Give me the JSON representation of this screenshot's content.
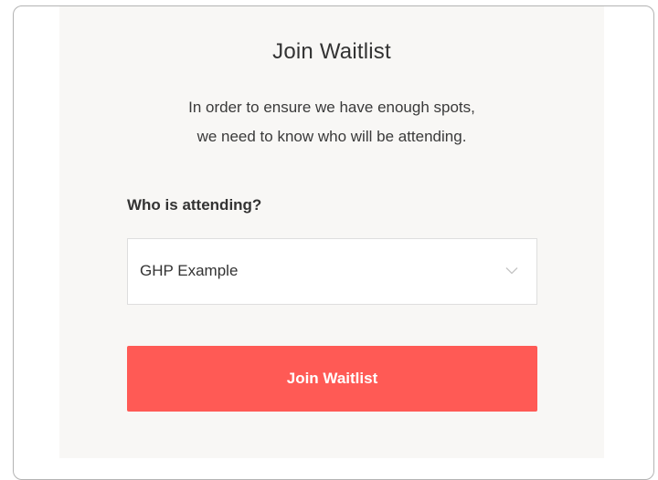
{
  "dialog": {
    "title": "Join Waitlist",
    "subtitle_line1": "In order to ensure we have enough spots,",
    "subtitle_line2": "we need to know who will be attending."
  },
  "form": {
    "question": "Who is attending?",
    "attendee_select": {
      "selected_value": "GHP Example",
      "icon": "chevron-down-icon"
    },
    "submit_label": "Join Waitlist"
  },
  "colors": {
    "panel_background": "#f8f7f5",
    "button_background": "#ff5a55",
    "button_text": "#ffffff",
    "text": "#333333"
  }
}
